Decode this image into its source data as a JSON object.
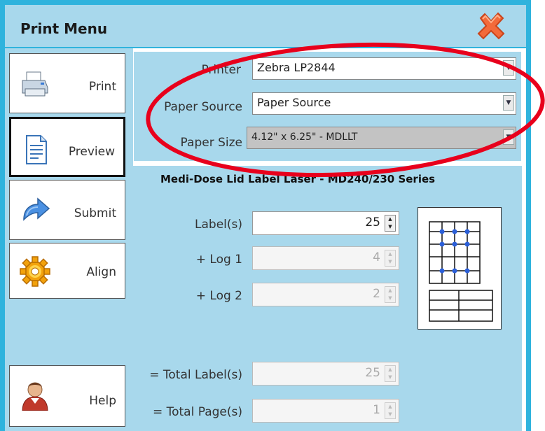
{
  "window": {
    "title": "Print Menu"
  },
  "nav": {
    "print": "Print",
    "preview": "Preview",
    "submit": "Submit",
    "align": "Align",
    "help": "Help"
  },
  "settings": {
    "printer": {
      "label": "Printer",
      "value": "Zebra  LP2844"
    },
    "paper_source": {
      "label": "Paper Source",
      "value": "Paper Source"
    },
    "paper_size": {
      "label": "Paper Size",
      "value": "4.12\" x 6.25\" - MDLLT"
    }
  },
  "label_section": {
    "title": "Medi-Dose Lid Label Laser - MD240/230 Series",
    "labels": {
      "label": "Label(s)",
      "value": "25"
    },
    "log1": {
      "label": "+ Log 1",
      "value": "4"
    },
    "log2": {
      "label": "+ Log 2",
      "value": "2"
    },
    "total_labels": {
      "label": "= Total Label(s)",
      "value": "25"
    },
    "total_pages": {
      "label": "= Total Page(s)",
      "value": "1"
    }
  },
  "colors": {
    "frame": "#2fb3dd",
    "panel": "#a8d8ec",
    "annotation": "#e8001c",
    "dot": "#2b5fd9"
  }
}
